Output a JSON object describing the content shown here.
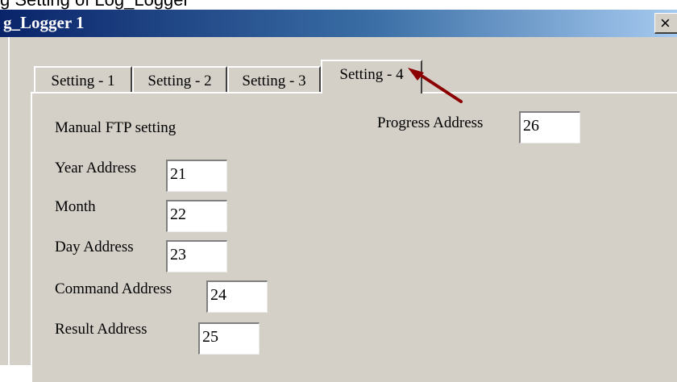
{
  "cropped_header_text": "g Setting   of Log_Logger",
  "window": {
    "title": "g_Logger 1",
    "close_label": "×"
  },
  "tabs": [
    {
      "label": "Setting - 1"
    },
    {
      "label": "Setting - 2"
    },
    {
      "label": "Setting - 3"
    },
    {
      "label": "Setting - 4"
    }
  ],
  "form": {
    "section_title": "Manual FTP setting",
    "year": {
      "label": "Year Address",
      "value": "21"
    },
    "month": {
      "label": "Month",
      "value": "22"
    },
    "day": {
      "label": "Day Address",
      "value": "23"
    },
    "command": {
      "label": "Command Address",
      "value": "24"
    },
    "result": {
      "label": "Result Address",
      "value": "25"
    },
    "progress": {
      "label": "Progress Address",
      "value": "26"
    }
  },
  "colors": {
    "title_start": "#0a246a",
    "title_end": "#a6caf0",
    "face": "#d4d0c8",
    "annotation_arrow": "#8b0000"
  }
}
